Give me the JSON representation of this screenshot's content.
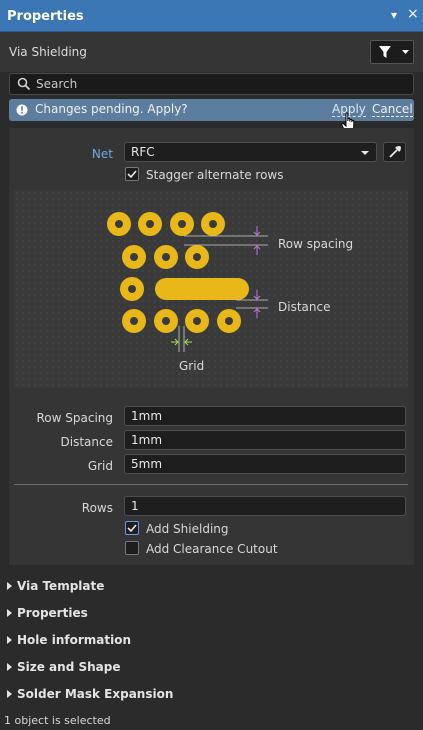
{
  "panel": {
    "title": "Properties",
    "close_glyph": "×",
    "menu_glyph": "▾"
  },
  "header": {
    "object_type": "Via Shielding",
    "filter_icon": "filter-icon"
  },
  "search": {
    "placeholder": "Search"
  },
  "pending": {
    "message": "Changes pending. Apply?",
    "apply_label": "Apply",
    "cancel_label": "Cancel"
  },
  "net": {
    "label": "Net",
    "value": "RFC"
  },
  "stagger": {
    "label": "Stagger alternate rows",
    "checked": true
  },
  "diagram": {
    "row_spacing_label": "Row spacing",
    "distance_label": "Distance",
    "grid_label": "Grid"
  },
  "fields": {
    "row_spacing": {
      "label": "Row Spacing",
      "value": "1mm"
    },
    "distance": {
      "label": "Distance",
      "value": "1mm"
    },
    "grid": {
      "label": "Grid",
      "value": "5mm"
    },
    "rows": {
      "label": "Rows",
      "value": "1"
    }
  },
  "options": {
    "add_shielding": {
      "label": "Add Shielding",
      "checked": true
    },
    "add_clearance_cutout": {
      "label": "Add Clearance Cutout",
      "checked": false
    }
  },
  "sections": [
    {
      "label": "Via Template"
    },
    {
      "label": "Properties"
    },
    {
      "label": "Hole information"
    },
    {
      "label": "Size and Shape"
    },
    {
      "label": "Solder Mask Expansion"
    }
  ],
  "status": {
    "text": "1 object is selected"
  },
  "colors": {
    "title_bar": "#3b77b5",
    "pending_bar": "#5c7d9e",
    "pad": "#e8b818",
    "dimension_purple": "#b77bd6",
    "dimension_green": "#a6d95b"
  }
}
